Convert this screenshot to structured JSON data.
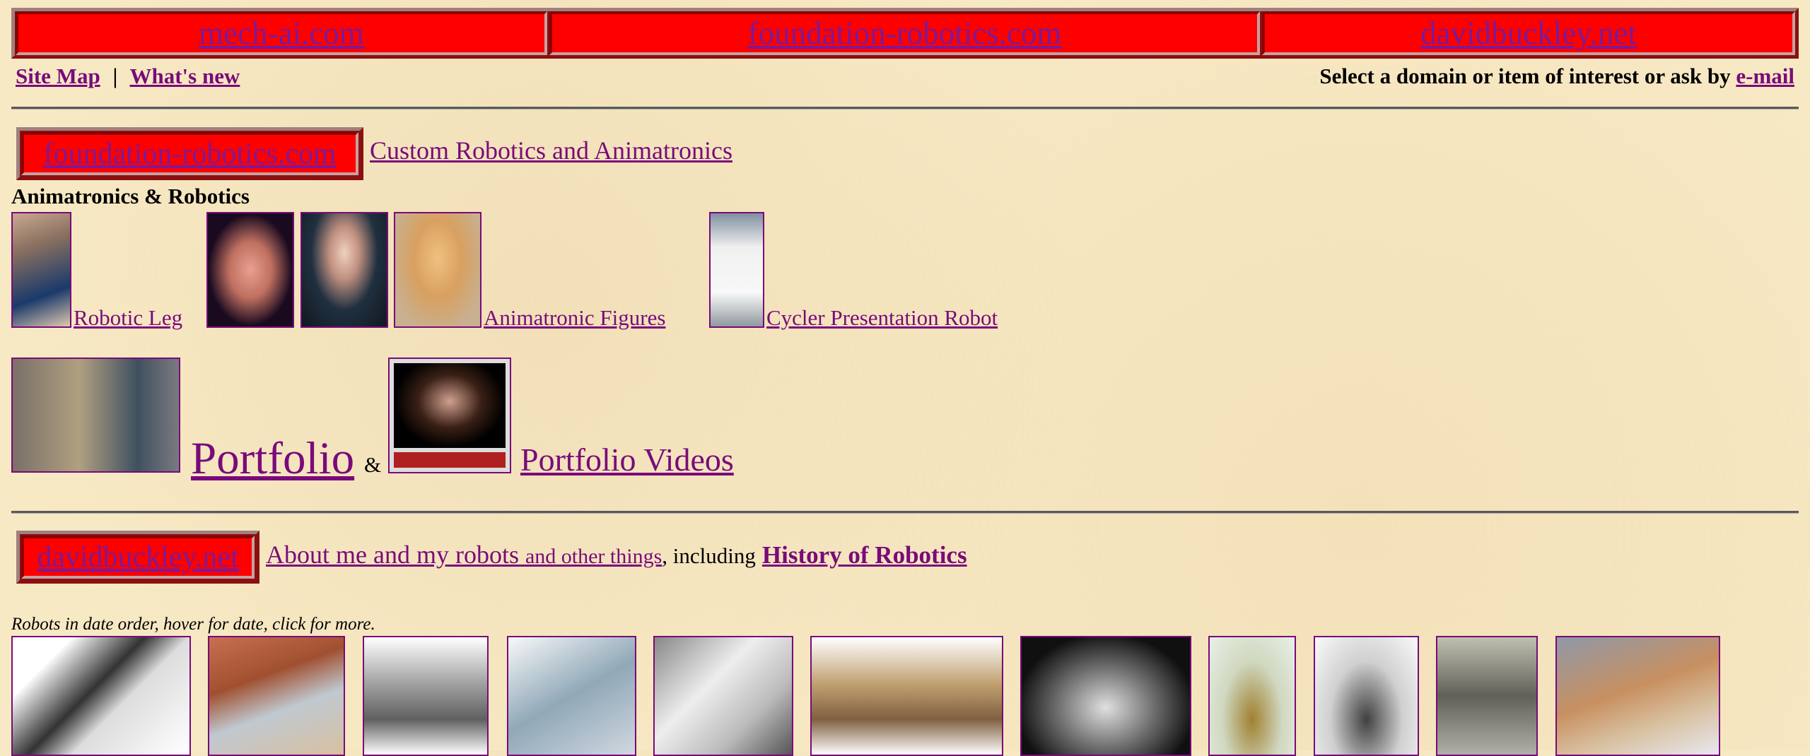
{
  "top_domains": [
    "mech-ai.com",
    "foundation-robotics.com",
    "davidbuckley.net"
  ],
  "nav": {
    "site_map": "Site Map",
    "separator": "|",
    "whats_new": "What's new",
    "prompt": "Select a domain or item of interest or ask by",
    "email": "e-mail"
  },
  "foundation": {
    "domain": "foundation-robotics.com",
    "tagline": "Custom Robotics and Animatronics",
    "heading": "Animatronics & Robotics",
    "items": {
      "leg": "Robotic  Leg",
      "figures": "Animatronic Figures",
      "cycler": "Cycler Presentation Robot"
    },
    "portfolio": "Portfolio",
    "amp": "&",
    "videos": "Portfolio Videos"
  },
  "buckley": {
    "domain": "davidbuckley.net",
    "about": "About me and my robots",
    "about_small": "and other things",
    "including": ", including",
    "history": "History of Robotics",
    "note": "Robots in date order, hover for date, click for more."
  },
  "colors": {
    "cell": "#ff0000",
    "link": "#7a0a7a",
    "background": "#f7e9c4"
  }
}
